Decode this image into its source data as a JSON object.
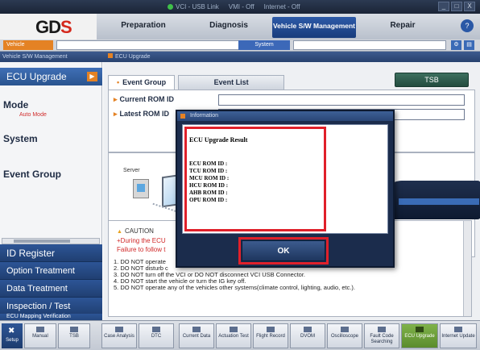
{
  "top_status": [
    "VCI - USB Link",
    "VMI - Off",
    "Internet - Off"
  ],
  "window_controls": [
    "_",
    "□",
    "X"
  ],
  "logo": {
    "brand_main": "GD",
    "brand_accent": "S"
  },
  "menu": {
    "tabs": [
      "Preparation",
      "Diagnosis",
      "Vehicle S/W Management",
      "Repair"
    ],
    "active_tab": "Vehicle S/W Management",
    "help": "?"
  },
  "subbar": {
    "vehicle_label": "Vehicle",
    "system_label": "System"
  },
  "breadcrumb": {
    "left": "Vehicle S/W Management",
    "right": "ECU Upgrade"
  },
  "sidebar": {
    "ecu_upgrade": "ECU Upgrade",
    "mode_label": "Mode",
    "mode_value": "Auto Mode",
    "system_label": "System",
    "event_group_label": "Event Group",
    "nav": [
      "ID Register",
      "Option Treatment",
      "Data Treatment",
      "Inspection / Test",
      "ECU Mapping Verification"
    ]
  },
  "content": {
    "tab_event_group": "Event Group",
    "tab_event_list": "Event List",
    "tsb_button": "TSB",
    "current_rom_label": "Current ROM ID",
    "latest_rom_label": "Latest ROM ID",
    "server_label": "Server",
    "caution": {
      "title": "CAUTION",
      "line1": "+During the ECU",
      "line2": "Failure to follow t",
      "items": [
        "1. DO NOT operate",
        "2. DO NOT disturb c",
        "3. DO NOT turn off the VCI or DO NOT disconnect VCI USB Connector.",
        "4. DO NOT start the vehicle or turn the IG key off.",
        "5. DO NOT operate any of the vehicles other systems(climate control, lighting, audio, etc.)."
      ]
    }
  },
  "dialog": {
    "title": "Information",
    "result_heading": "ECU Upgrade Result",
    "rom_lines": [
      "ECU ROM ID :",
      "TCU ROM ID :",
      "MCU ROM ID :",
      "HCU ROM ID :",
      "AHB ROM ID :",
      "OPU ROM ID :"
    ],
    "ok_button": "OK"
  },
  "bottom_toolbar": {
    "setup_label": "Setup",
    "buttons": [
      "Manual",
      "TSB",
      "Case Analysis",
      "DTC",
      "Current Data",
      "Actuation Test",
      "Flight Record",
      "DVOM",
      "Oscilloscope",
      "Fault Code Searching",
      "ECU Upgrade",
      "Internet Update"
    ],
    "active": "ECU Upgrade"
  },
  "colors": {
    "accent_orange": "#e48224",
    "nav_blue": "#2d5596",
    "highlight_red": "#e0202a",
    "caution_red": "#d02828"
  }
}
